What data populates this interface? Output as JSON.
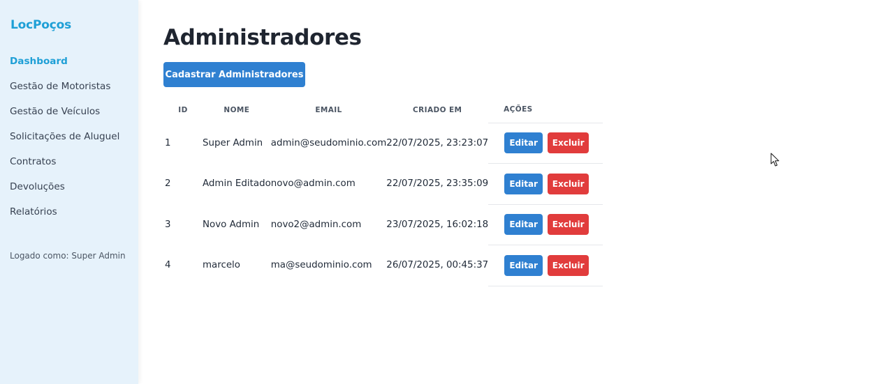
{
  "sidebar": {
    "brand": "LocPoços",
    "items": [
      {
        "label": "Dashboard",
        "active": true
      },
      {
        "label": "Gestão de Motoristas",
        "active": false
      },
      {
        "label": "Gestão de Veículos",
        "active": false
      },
      {
        "label": "Solicitações de Aluguel",
        "active": false
      },
      {
        "label": "Contratos",
        "active": false
      },
      {
        "label": "Devoluções",
        "active": false
      },
      {
        "label": "Relatórios",
        "active": false
      }
    ],
    "logged_as": "Logado como: Super Admin"
  },
  "main": {
    "title": "Administradores",
    "create_button": "Cadastrar Administradores",
    "table": {
      "headers": [
        "ID",
        "NOME",
        "EMAIL",
        "CRIADO EM",
        "AÇÕES"
      ],
      "rows": [
        {
          "id": "1",
          "nome": "Super Admin",
          "email": "admin@seudominio.com",
          "criado_em": "22/07/2025, 23:23:07"
        },
        {
          "id": "2",
          "nome": "Admin Editado",
          "email": "novo@admin.com",
          "criado_em": "22/07/2025, 23:35:09"
        },
        {
          "id": "3",
          "nome": "Novo Admin",
          "email": "novo2@admin.com",
          "criado_em": "23/07/2025, 16:02:18"
        },
        {
          "id": "4",
          "nome": "marcelo",
          "email": "ma@seudominio.com",
          "criado_em": "26/07/2025, 00:45:37"
        }
      ],
      "edit_label": "Editar",
      "delete_label": "Excluir"
    }
  },
  "colors": {
    "brand": "#1e9fd6",
    "sidebar_bg": "#e6f2fb",
    "primary": "#2f80d1",
    "danger": "#e13c3c"
  },
  "cursor_icon": "mouse-pointer-icon"
}
